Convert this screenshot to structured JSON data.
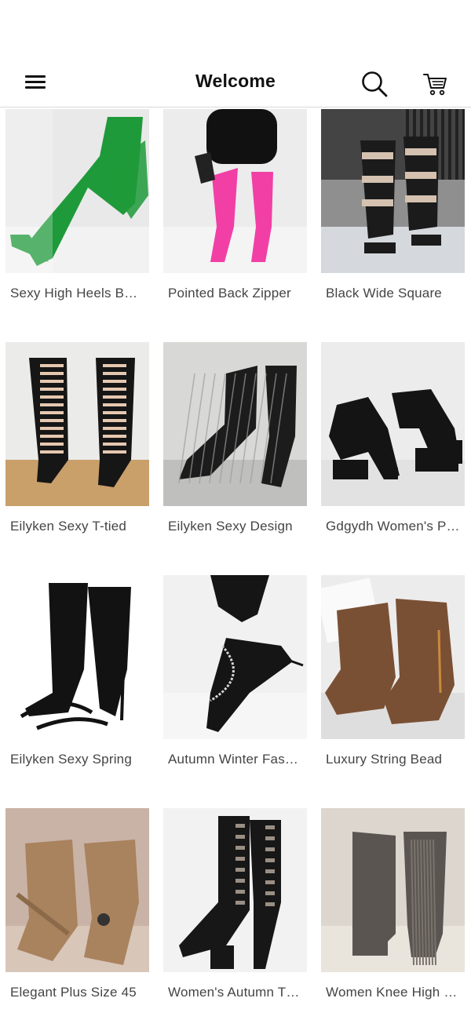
{
  "header": {
    "title": "Welcome",
    "menu_icon": "hamburger-menu-icon",
    "search_icon": "search-icon",
    "cart_icon": "cart-icon"
  },
  "products": [
    {
      "title": "Sexy High Heels Boots",
      "bg": "#e9e9e9",
      "floor": "#f2f2f2",
      "boot": "#1f9a3a",
      "style": "ankle"
    },
    {
      "title": "Pointed Back Zipper",
      "bg": "#ececec",
      "floor": "#f4f4f4",
      "boot": "#f23fa5",
      "style": "thigh"
    },
    {
      "title": "Black Wide Square",
      "bg": "#8f8f8f",
      "floor": "#d5d8dc",
      "boot": "#1b1b1b",
      "style": "cage"
    },
    {
      "title": "Eilyken Sexy T-tied",
      "bg": "#ebebea",
      "floor": "#c99f6a",
      "boot": "#161616",
      "style": "lace"
    },
    {
      "title": "Eilyken Sexy Design",
      "bg": "#d8d8d6",
      "floor": "#bfbfbd",
      "boot": "#1c1c1c",
      "style": "mesh"
    },
    {
      "title": "Gdgydh Women's Platform",
      "bg": "#ececec",
      "floor": "#e2e2e2",
      "boot": "#141414",
      "style": "platform"
    },
    {
      "title": "Eilyken Sexy Spring",
      "bg": "#ffffff",
      "floor": "#ffffff",
      "boot": "#121212",
      "style": "sock"
    },
    {
      "title": "Autumn Winter Fashion",
      "bg": "#f1f1f1",
      "floor": "#f6f6f6",
      "boot": "#151515",
      "style": "chain"
    },
    {
      "title": "Luxury String Bead",
      "bg": "#ececec",
      "floor": "#dedede",
      "boot": "#7a5034",
      "style": "suede"
    },
    {
      "title": "Elegant Plus Size 45",
      "bg": "#c9b3a6",
      "floor": "#d8c6b9",
      "boot": "#a9825e",
      "style": "beige"
    },
    {
      "title": "Women's Autumn Thick",
      "bg": "#f2f2f2",
      "floor": "#f2f2f2",
      "boot": "#171717",
      "style": "buckle"
    },
    {
      "title": "Women Knee High Fringe",
      "bg": "#dcd6cf",
      "floor": "#e9e4dc",
      "boot": "#5a5551",
      "style": "fringe"
    }
  ]
}
